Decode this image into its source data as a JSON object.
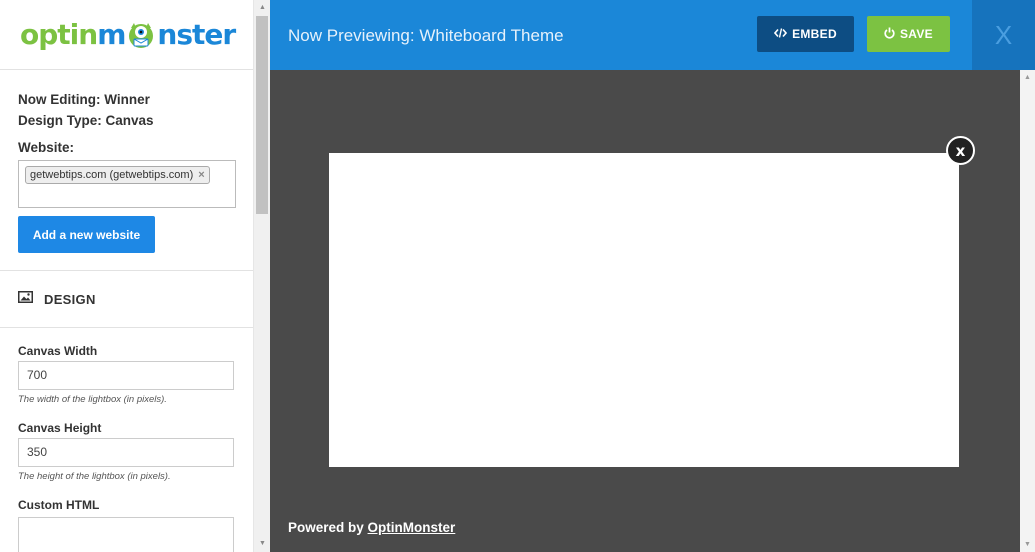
{
  "logo": {
    "part1": "optin",
    "part2": "m",
    "part3": "nster",
    "brand_green": "#7cc242",
    "brand_blue": "#1b87d8"
  },
  "sidebar": {
    "now_editing": "Now Editing: Winner",
    "design_type": "Design Type: Canvas",
    "website_label": "Website:",
    "website_tag": "getwebtips.com (getwebtips.com)",
    "website_tag_remove": "×",
    "add_website_label": "Add a new website",
    "design_section": {
      "icon": "image-icon",
      "label": "DESIGN"
    },
    "fields": {
      "canvas_width": {
        "label": "Canvas Width",
        "value": "700",
        "help": "The width of the lightbox (in pixels)."
      },
      "canvas_height": {
        "label": "Canvas Height",
        "value": "350",
        "help": "The height of the lightbox (in pixels)."
      },
      "custom_html": {
        "label": "Custom HTML",
        "value": ""
      }
    }
  },
  "header": {
    "title": "Now Previewing: Whiteboard Theme",
    "embed_label": "EMBED",
    "embed_icon": "code-icon",
    "save_label": "SAVE",
    "save_icon": "power-icon",
    "close_icon": "close-icon",
    "close_glyph": "X"
  },
  "preview": {
    "close_glyph": "x",
    "powered_prefix": "Powered by",
    "powered_link": "OptinMonster"
  },
  "colors": {
    "header_bg": "#1b87d8",
    "embed_bg": "#0d4d83",
    "save_bg": "#7cc242",
    "preview_bg": "#4a4a4a",
    "primary_button": "#1e88e5"
  }
}
